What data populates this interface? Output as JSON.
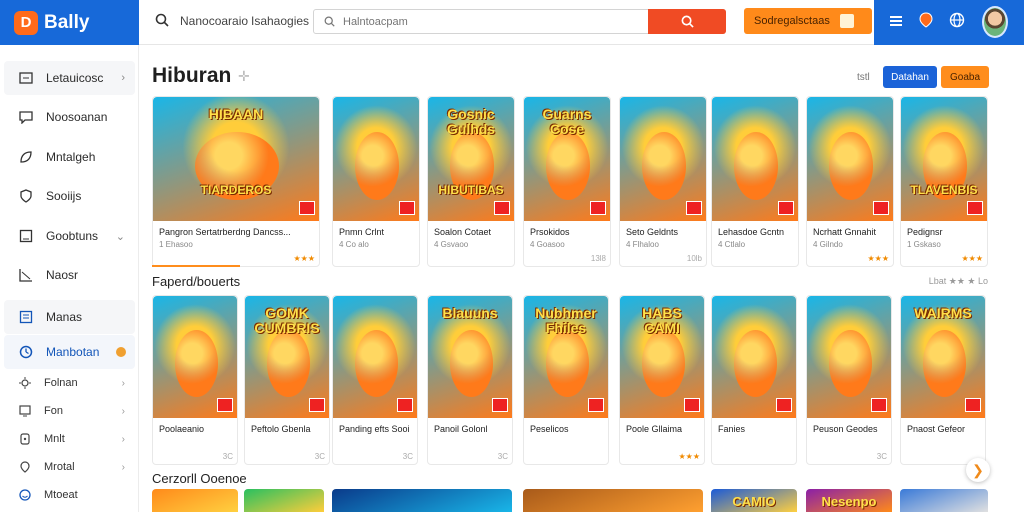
{
  "brand": {
    "name": "Bally",
    "accent": "#1769d9",
    "orange": "#ff8a1a",
    "red": "#f04b24"
  },
  "header": {
    "links": [
      "Nanocoaraio",
      "Isahaogies"
    ],
    "search": {
      "placeholder": "Halntoacpam"
    },
    "promo_label": "Sodregalsctaas",
    "right_icons": [
      "menu-icon",
      "location-icon",
      "language-icon"
    ]
  },
  "sidebar": {
    "items": [
      {
        "label": "Letauicosc",
        "icon": "tv-icon"
      },
      {
        "label": "Noosoanan",
        "icon": "chat-icon"
      },
      {
        "label": "Mntalgeh",
        "icon": "leaf-icon"
      },
      {
        "label": "Sooiijs",
        "icon": "shield-icon"
      },
      {
        "label": "Goobtuns",
        "icon": "tag-icon"
      },
      {
        "label": "Naosr",
        "icon": "chart-icon"
      },
      {
        "label": "Manas",
        "icon": "list-icon"
      },
      {
        "label": "Manbotan",
        "icon": "clock-icon"
      }
    ],
    "subitems": [
      {
        "label": "Folnan",
        "icon": "sun-icon"
      },
      {
        "label": "Fon",
        "icon": "monitor-icon"
      },
      {
        "label": "Mnlt",
        "icon": "box-icon"
      },
      {
        "label": "Mrotal",
        "icon": "pin-icon"
      },
      {
        "label": "Mtoeat",
        "icon": "smile-icon"
      }
    ]
  },
  "main": {
    "title": "Hiburan",
    "toolbar_text": "tstl",
    "btn_blue": "Datahan",
    "btn_orange": "Goaba",
    "sections": [
      {
        "label": "Faperd/bouerts",
        "right": "Lbat ★★ ★ Lo"
      },
      {
        "label": "Cerzorll Ooenoe"
      }
    ],
    "row1": [
      {
        "art": "HIBAAN",
        "subart": "TIARDEROS",
        "name": "Pangron Sertatrberdng Dancss...",
        "meta": "1 Ehasoo",
        "stars": "★★★"
      },
      {
        "art": "",
        "subart": "",
        "name": "Pnmn Crlnt",
        "meta": "4 Co alo",
        "stars": ""
      },
      {
        "art": "Gosnic Gulhds",
        "subart": "HIBUTIBAS",
        "name": "Soalon Cotaet",
        "meta": "4 Gsvaoo",
        "stars": ""
      },
      {
        "art": "Guarns Cose",
        "subart": "",
        "name": "Prsokidos",
        "meta": "4 Goasoo",
        "stars": "13l8"
      },
      {
        "art": "",
        "subart": "",
        "name": "Seto Geldnts",
        "meta": "4 Flhaloo",
        "stars": "10lb"
      },
      {
        "art": "",
        "subart": "",
        "name": "Lehasdoe Gcntn",
        "meta": "4 Ctlalo",
        "stars": ""
      },
      {
        "art": "",
        "subart": "",
        "name": "Ncrhatt Gnnahit",
        "meta": "4 Gilndo",
        "stars": "★★★"
      },
      {
        "art": "",
        "subart": "TLAVENBIS",
        "name": "Pedignsr",
        "meta": "1 Gskaso",
        "stars": "★★★"
      }
    ],
    "row2": [
      {
        "art": "",
        "subart": "",
        "name": "Poolaeanio",
        "meta": "",
        "stars": "3C"
      },
      {
        "art": "GOMK CUMBRIS",
        "subart": "",
        "name": "Peftolo Gbenla",
        "meta": "",
        "stars": "3C"
      },
      {
        "art": "",
        "subart": "",
        "name": "Panding efts Sooi",
        "meta": "",
        "stars": "3C"
      },
      {
        "art": "Blauuns",
        "subart": "",
        "name": "Panoil Golonl",
        "meta": "",
        "stars": "3C"
      },
      {
        "art": "Nubhmer Fhiles",
        "subart": "",
        "name": "Peselicos",
        "meta": "",
        "stars": ""
      },
      {
        "art": "HABS CAMI",
        "subart": "",
        "name": "Poole Gllaima",
        "meta": "",
        "stars": "★★★"
      },
      {
        "art": "",
        "subart": "",
        "name": "Fanies",
        "meta": "",
        "stars": ""
      },
      {
        "art": "",
        "subart": "",
        "name": "Peuson Geodes",
        "meta": "",
        "stars": "3C"
      },
      {
        "art": "WAIRMS",
        "subart": "",
        "name": "Pnaost Gefeor",
        "meta": "",
        "stars": ""
      }
    ],
    "row3_labels": [
      "",
      "",
      "",
      "",
      "CAMIO",
      "Nesenpo",
      ""
    ]
  }
}
